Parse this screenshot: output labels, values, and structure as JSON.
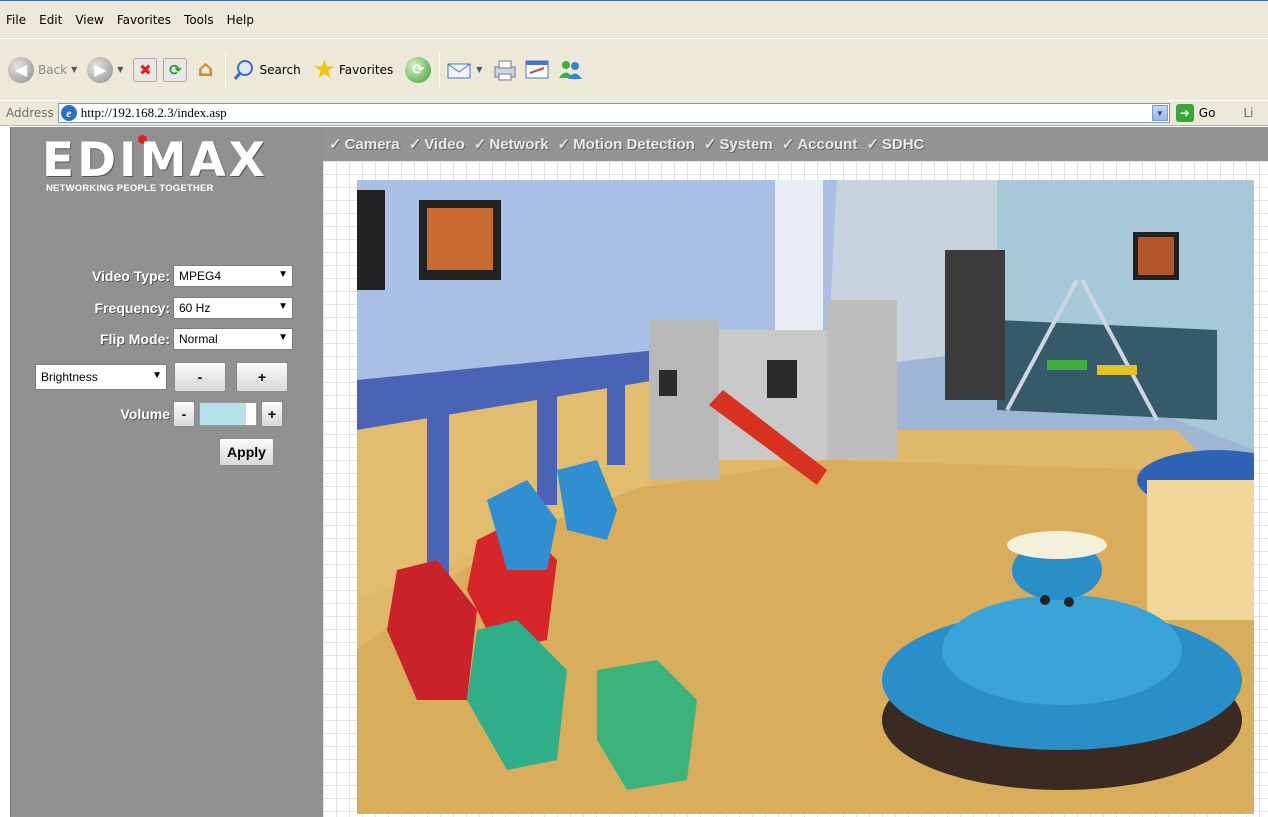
{
  "menu": [
    "File",
    "Edit",
    "View",
    "Favorites",
    "Tools",
    "Help"
  ],
  "toolbar": {
    "back": "Back",
    "search": "Search",
    "favorites": "Favorites"
  },
  "address": {
    "label": "Address",
    "url": "http://192.168.2.3/index.asp",
    "go": "Go",
    "links": "Li"
  },
  "logo": {
    "brand": "EDIMAX",
    "tagline": "NETWORKING PEOPLE TOGETHER"
  },
  "nav": [
    "Camera",
    "Video",
    "Network",
    "Motion Detection",
    "System",
    "Account",
    "SDHC"
  ],
  "controls": {
    "video_type_label": "Video Type:",
    "video_type_value": "MPEG4",
    "frequency_label": "Frequency:",
    "frequency_value": "60 Hz",
    "flip_label": "Flip Mode:",
    "flip_value": "Normal",
    "adjust_value": "Brightness",
    "minus": "-",
    "plus": "+",
    "volume_label": "Volume",
    "apply": "Apply"
  },
  "colors": {
    "chrome": "#ece9d8",
    "sidebar": "#8f8f8f",
    "volume_fill": "#b6e0ea"
  }
}
